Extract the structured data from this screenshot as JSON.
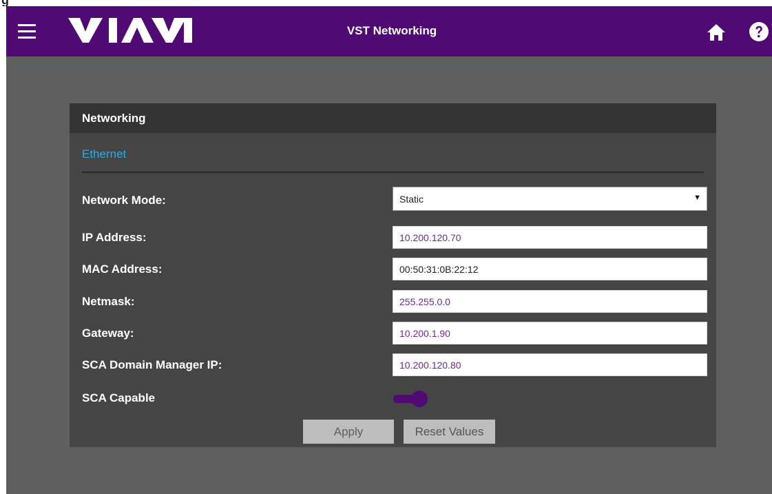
{
  "partial_caption": "g",
  "header": {
    "logo_text": "VIAVI",
    "title": "VST Networking",
    "icons": {
      "menu": "hamburger-menu-icon",
      "home": "home-icon",
      "help": "help-icon"
    },
    "background": "#4f0a73"
  },
  "panel": {
    "title": "Networking",
    "tab_label": "Ethernet",
    "tab_color": "#2fa9df",
    "fields": {
      "network_mode": {
        "label": "Network Mode:",
        "value": "Static"
      },
      "ip_address": {
        "label": "IP Address:",
        "value": "10.200.120.70"
      },
      "mac_address": {
        "label": "MAC Address:",
        "value": "00:50:31:0B:22:12"
      },
      "netmask": {
        "label": "Netmask:",
        "value": "255.255.0.0"
      },
      "gateway": {
        "label": "Gateway:",
        "value": "10.200.1.90"
      },
      "sca_domain_manager_ip": {
        "label": "SCA Domain Manager IP:",
        "value": "10.200.120.80"
      },
      "sca_capable": {
        "label": "SCA Capable",
        "state": "on"
      }
    },
    "buttons": {
      "apply": "Apply",
      "reset": "Reset Values"
    },
    "accent_color": "#4f0a73"
  }
}
